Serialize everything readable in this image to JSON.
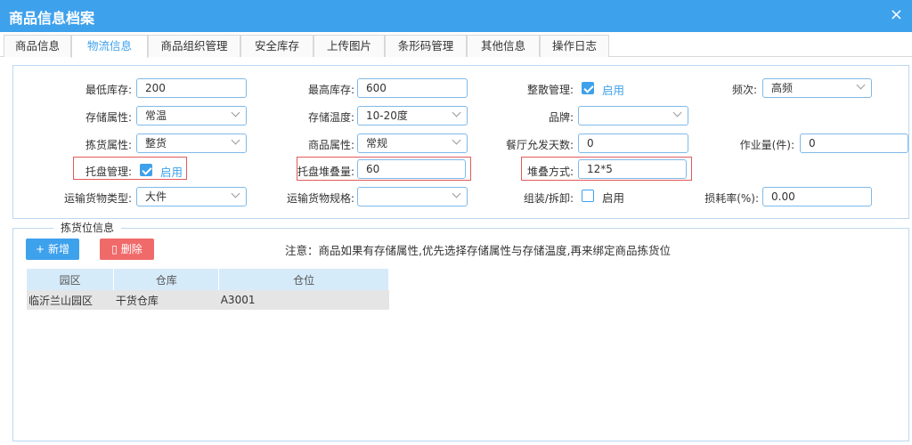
{
  "window": {
    "title": "商品信息档案",
    "close": "×"
  },
  "tabs": [
    "商品信息",
    "物流信息",
    "商品组织管理",
    "安全库存",
    "上传图片",
    "条形码管理",
    "其他信息",
    "操作日志"
  ],
  "form": {
    "min_stock_label": "最低库存:",
    "min_stock_value": "200",
    "max_stock_label": "最高库存:",
    "max_stock_value": "600",
    "bulk_mgmt_label": "整散管理:",
    "bulk_mgmt_text": "启用",
    "frequency_label": "频次:",
    "frequency_value": "高频",
    "storage_attr_label": "存储属性:",
    "storage_attr_value": "常温",
    "storage_temp_label": "存储温度:",
    "storage_temp_value": "10-20度",
    "brand_label": "品牌:",
    "brand_value": "",
    "picking_attr_label": "拣货属性:",
    "picking_attr_value": "整货",
    "product_attr_label": "商品属性:",
    "product_attr_value": "常规",
    "allow_days_label": "餐厅允发天数:",
    "allow_days_value": "0",
    "workload_label": "作业量(件):",
    "workload_value": "0",
    "pallet_mgmt_label": "托盘管理:",
    "pallet_mgmt_text": "启用",
    "pallet_stack_label": "托盘堆叠量:",
    "pallet_stack_value": "60",
    "stack_method_label": "堆叠方式:",
    "stack_method_value": "12*5",
    "transport_type_label": "运输货物类型:",
    "transport_type_value": "大件",
    "transport_spec_label": "运输货物规格:",
    "transport_spec_value": "",
    "assembly_label": "组装/拆卸:",
    "assembly_text": "启用",
    "loss_rate_label": "损耗率(%):",
    "loss_rate_value": "0.00"
  },
  "picking": {
    "legend": "拣货位信息",
    "add_label": "新增",
    "delete_label": "删除",
    "note": "注意：商品如果有存储属性,优先选择存储属性与存储温度,再来绑定商品拣货位",
    "columns": [
      "园区",
      "仓库",
      "仓位"
    ],
    "rows": [
      [
        "临沂兰山园区",
        "干货仓库",
        "A3001"
      ]
    ]
  },
  "colors": {
    "accent": "#3ea1ec",
    "danger": "#f06a6a",
    "highlight": "#e35a5a"
  }
}
